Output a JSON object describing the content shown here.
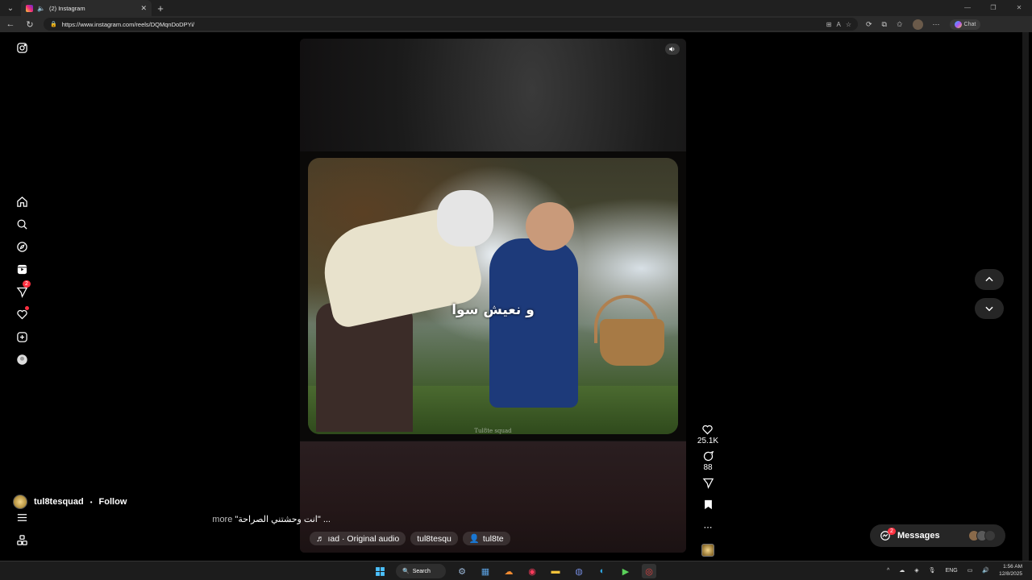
{
  "browser": {
    "tab_title": "(2) Instagram",
    "url": "https://www.instagram.com/reels/DQMqnDoDPYi/",
    "chat_label": "Chat"
  },
  "sidebar": {
    "notification_badge": "2"
  },
  "reel": {
    "overlay_text": "و نعيش سوا",
    "watermark": "Tul8te squad",
    "author": "tul8tesquad",
    "follow_label": "Follow",
    "separator": "•",
    "caption": "\"انت وحشتني الصراحة\" ...",
    "more_label": "more",
    "audio_chip": "ıad · Original audio",
    "collab_chip": "tul8tesqu",
    "tag_chip": "tul8te"
  },
  "actions": {
    "likes": "25.1K",
    "comments": "88"
  },
  "messages": {
    "label": "Messages",
    "badge": "2"
  },
  "taskbar": {
    "search_label": "Search",
    "language": "ENG",
    "time": "1:56 AM",
    "date": "12/8/2025"
  },
  "colors": {
    "notification_red": "#ff3040",
    "page_bg": "#000000"
  }
}
